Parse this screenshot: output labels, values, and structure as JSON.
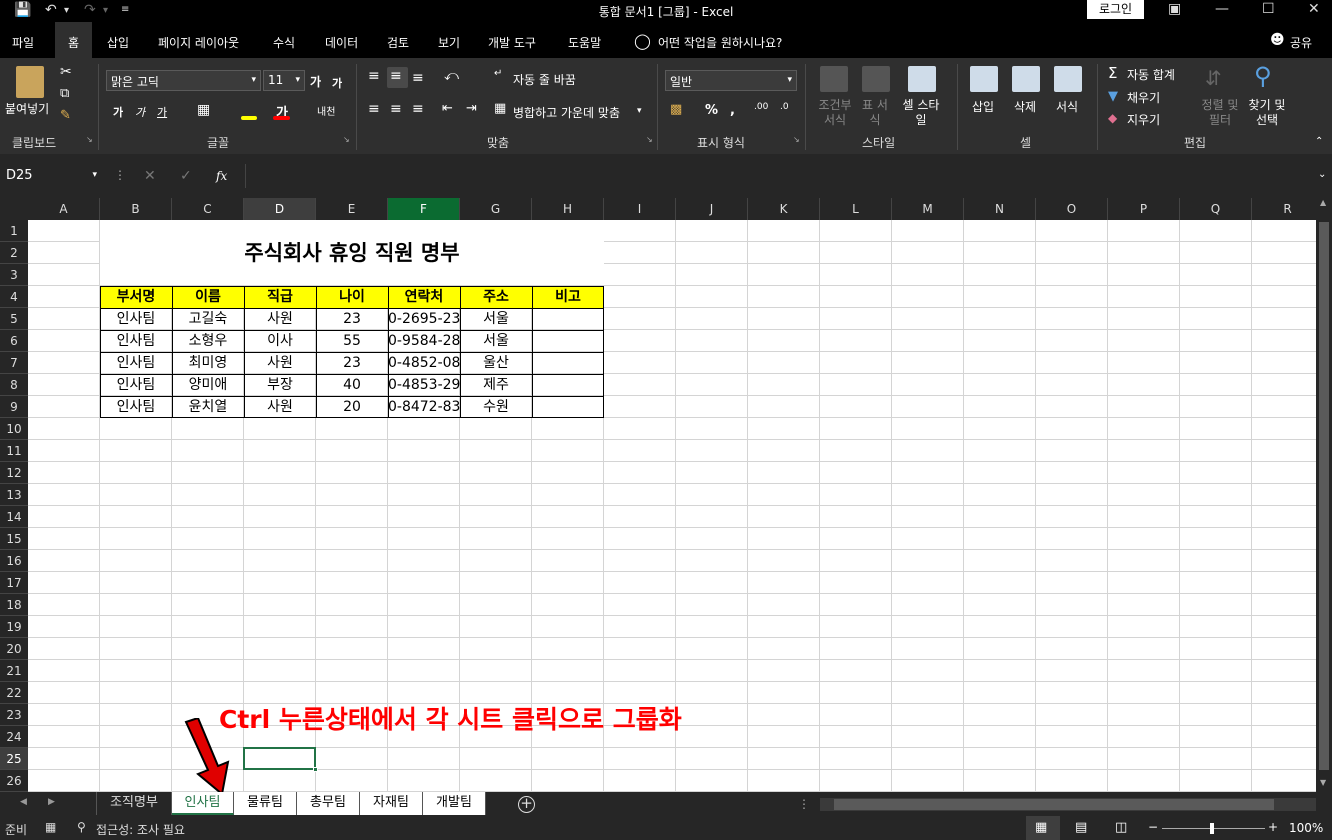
{
  "title_bar": {
    "title": "통합 문서1  [그룹]  -  Excel",
    "login": "로그인"
  },
  "menu": {
    "items": [
      "파일",
      "홈",
      "삽입",
      "페이지 레이아웃",
      "수식",
      "데이터",
      "검토",
      "보기",
      "개발 도구",
      "도움말"
    ],
    "active": "홈",
    "tell_me": "어떤 작업을 원하시나요?",
    "share": "공유"
  },
  "ribbon": {
    "clipboard": {
      "paste": "붙여넣기",
      "label": "클립보드"
    },
    "font": {
      "name": "맑은 고딕",
      "size": "11",
      "label": "글꼴"
    },
    "alignment": {
      "wrap": "자동 줄 바꿈",
      "merge": "병합하고 가운데 맞춤",
      "label": "맞춤"
    },
    "number": {
      "format": "일반",
      "label": "표시 형식"
    },
    "styles": {
      "cond": "조건부 서식",
      "table": "표 서식",
      "cell": "셀 스타일",
      "label": "스타일"
    },
    "cells": {
      "insert": "삽입",
      "delete": "삭제",
      "format": "서식",
      "label": "셀"
    },
    "editing": {
      "autosum": "자동 합계",
      "fill": "채우기",
      "clear": "지우기",
      "sort": "정렬 및 필터",
      "find": "찾기 및 선택",
      "label": "편집"
    }
  },
  "formula_bar": {
    "name_box": "D25",
    "fx": "fx",
    "value": ""
  },
  "grid": {
    "columns": [
      "A",
      "B",
      "C",
      "D",
      "E",
      "F",
      "G",
      "H",
      "I",
      "J",
      "K",
      "L",
      "M",
      "N",
      "O",
      "P",
      "Q",
      "R"
    ],
    "rows": [
      "1",
      "2",
      "3",
      "4",
      "5",
      "6",
      "7",
      "8",
      "9",
      "10",
      "11",
      "12",
      "13",
      "14",
      "15",
      "16",
      "17",
      "18",
      "19",
      "20",
      "21",
      "22",
      "23",
      "24",
      "25",
      "26"
    ],
    "sheet_title": "주식회사 휴잉 직원 명부",
    "headers": [
      "부서명",
      "이름",
      "직급",
      "나이",
      "연락처",
      "주소",
      "비고"
    ],
    "table_rows": [
      [
        "인사팀",
        "고길숙",
        "사원",
        "23",
        "0-2695-23",
        "서울",
        ""
      ],
      [
        "인사팀",
        "소형우",
        "이사",
        "55",
        "0-9584-28",
        "서울",
        ""
      ],
      [
        "인사팀",
        "최미영",
        "사원",
        "23",
        "0-4852-08",
        "울산",
        ""
      ],
      [
        "인사팀",
        "양미애",
        "부장",
        "40",
        "0-4853-29",
        "제주",
        ""
      ],
      [
        "인사팀",
        "윤치열",
        "사원",
        "20",
        "0-8472-83",
        "수원",
        ""
      ]
    ]
  },
  "annotation": "Ctrl 누른상태에서 각 시트 클릭으로 그룹화",
  "sheet_tabs": {
    "tabs": [
      "조직명부",
      "인사팀",
      "물류팀",
      "총무팀",
      "자재팀",
      "개발팀"
    ],
    "active": "인사팀"
  },
  "status_bar": {
    "ready": "준비",
    "accessibility": "접근성: 조사 필요",
    "zoom": "100%"
  }
}
